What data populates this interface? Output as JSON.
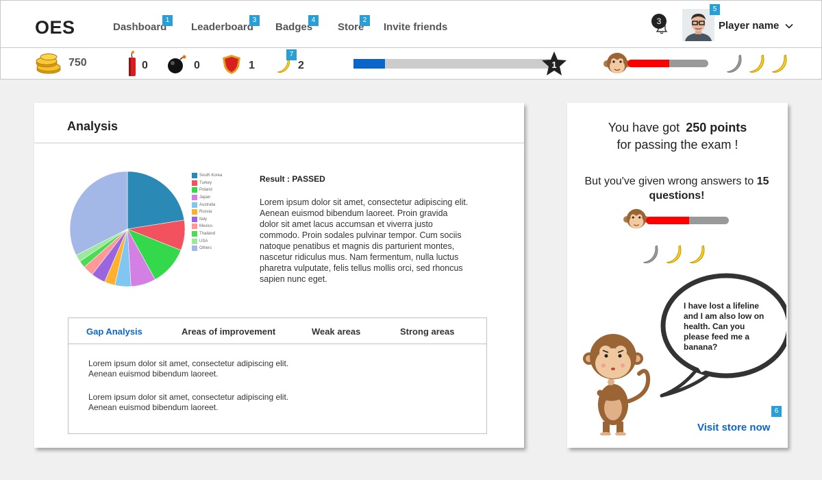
{
  "app": {
    "logo": "OES"
  },
  "nav": {
    "items": [
      {
        "label": "Dashboard",
        "badge": "1"
      },
      {
        "label": "Leaderboard",
        "badge": "3"
      },
      {
        "label": "Badges",
        "badge": "4"
      },
      {
        "label": "Store",
        "badge": "2"
      },
      {
        "label": "Invite friends"
      }
    ],
    "notifications_count": "3",
    "profile_badge": "5",
    "player_name": "Player name"
  },
  "stats": {
    "coins": "750",
    "dynamite": "0",
    "bombs": "0",
    "shields": "1",
    "bananas": "2",
    "banana_badge": "7",
    "level": "1",
    "xp_progress_percent": 16,
    "health_percent": 52,
    "lives_total": 3,
    "lives_lost": 1
  },
  "analysis": {
    "title": "Analysis",
    "result_text": "Result : PASSED",
    "description": "Lorem ipsum dolor sit amet, consectetur adipiscing elit. Aenean euismod bibendum laoreet. Proin gravida dolor sit amet lacus accumsan et viverra justo commodo. Proin sodales pulvinar tempor. Cum sociis natoque penatibus et magnis dis parturient montes, nascetur ridiculus mus. Nam fermentum, nulla luctus pharetra vulputate, felis tellus mollis orci, sed rhoncus sapien nunc eget.",
    "tabs": [
      "Gap Analysis",
      "Areas of improvement",
      "Weak areas",
      "Strong areas"
    ],
    "active_tab": "Gap Analysis",
    "tab_paragraphs": [
      "Lorem ipsum dolor sit amet, consectetur adipiscing elit. Aenean euismod bibendum laoreet.",
      "Lorem ipsum dolor sit amet, consectetur adipiscing elit. Aenean euismod bibendum laoreet."
    ]
  },
  "chart_data": {
    "type": "pie",
    "categories": [
      "South Korea",
      "Turkey",
      "Poland",
      "Japan",
      "Australia",
      "Russia",
      "Italy",
      "Mexico",
      "Thailand",
      "USA",
      "Others"
    ],
    "values": [
      22.5,
      8.5,
      11,
      7,
      4.5,
      3,
      4,
      3,
      2,
      2,
      32.5
    ],
    "colors": [
      "#2a89b5",
      "#f2525e",
      "#33d94a",
      "#d47fe3",
      "#80c6f2",
      "#ffb02e",
      "#9966e0",
      "#ff9999",
      "#4cdb52",
      "#9ce89c",
      "#a3b8e6"
    ]
  },
  "result_card": {
    "line1_prefix": "You have got",
    "points": "250 points",
    "line2": "for passing the exam !",
    "wrong_prefix": "But you've given wrong answers to",
    "wrong_count": "15",
    "wrong_suffix": "questions!",
    "health_percent": 52,
    "bubble_text": "I have lost a lifeline and I am also low on health. Can you please feed me a banana?",
    "store_badge": "6",
    "visit_store": "Visit store now"
  }
}
